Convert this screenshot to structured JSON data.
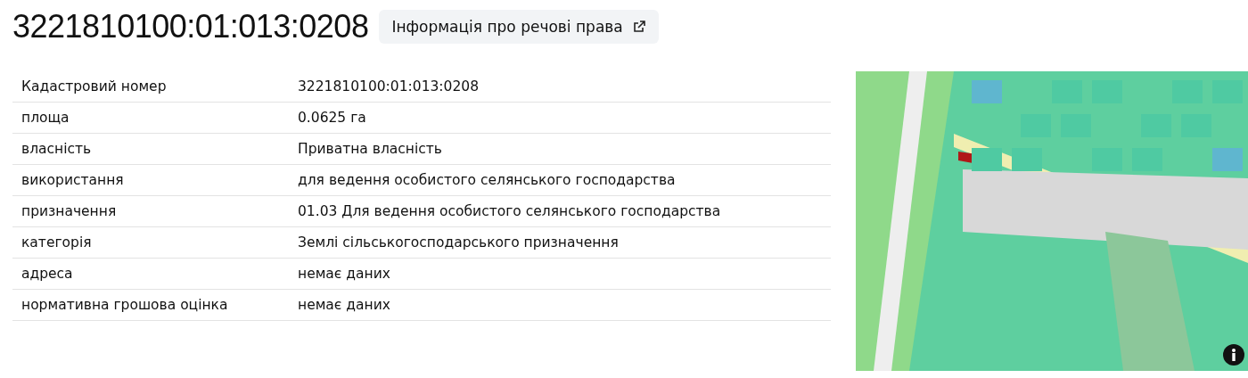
{
  "title": "3221810100:01:013:0208",
  "rights_button": {
    "label": "Інформація про речові права"
  },
  "table": {
    "rows": [
      {
        "label": "Кадастровий номер",
        "value": "3221810100:01:013:0208"
      },
      {
        "label": "площа",
        "value": "0.0625 га"
      },
      {
        "label": "власність",
        "value": "Приватна власність"
      },
      {
        "label": "використання",
        "value": "для ведення особистого селянського господарства"
      },
      {
        "label": "призначення",
        "value": "01.03 Для ведення особистого селянського господарства"
      },
      {
        "label": "категорія",
        "value": "Землі сільськогосподарського призначення"
      },
      {
        "label": "адреса",
        "value": "немає даних"
      },
      {
        "label": "нормативна грошова оцінка",
        "value": "немає даних"
      }
    ]
  }
}
